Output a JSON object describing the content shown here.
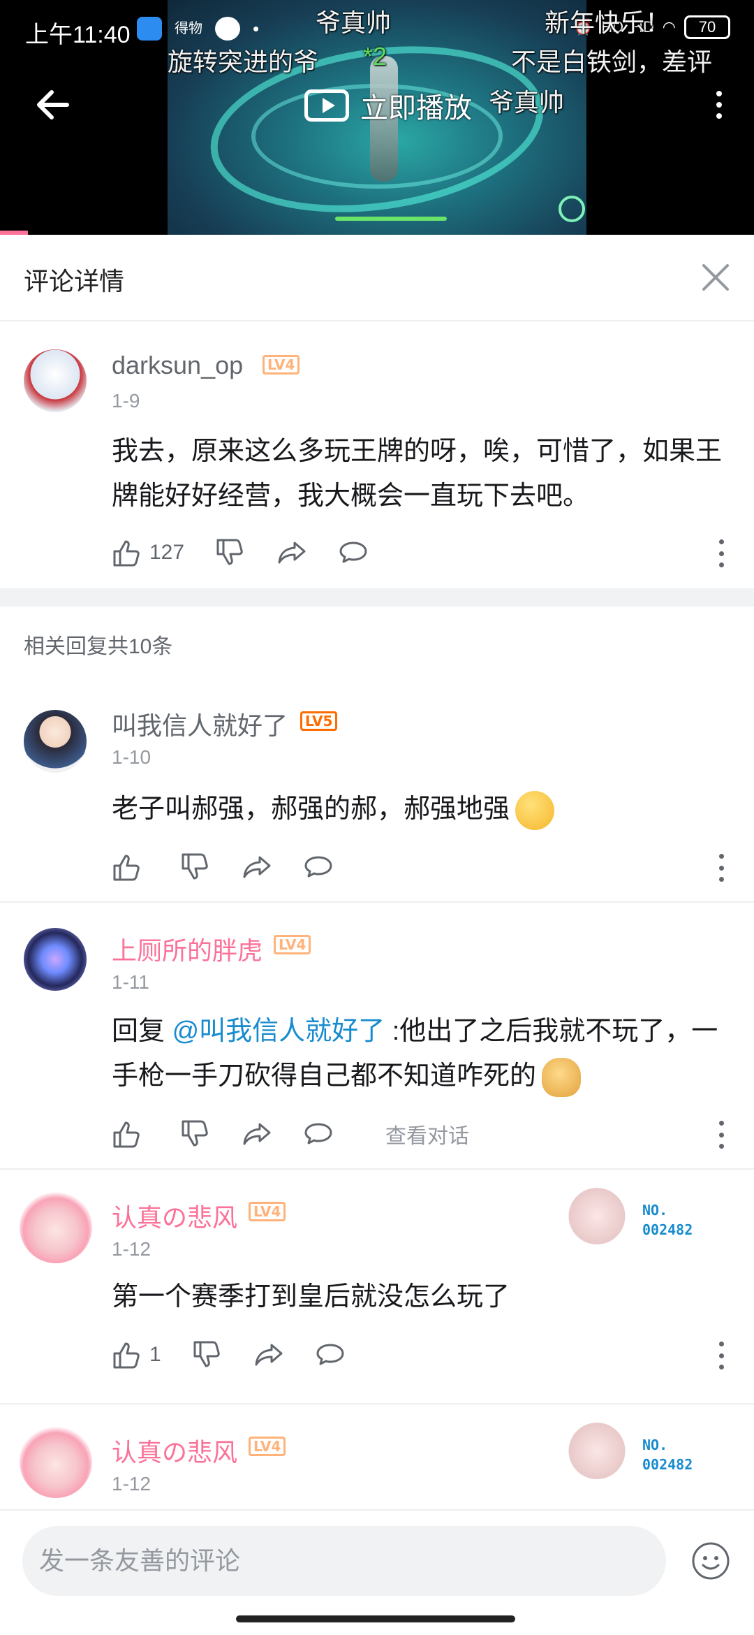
{
  "status_bar": {
    "time": "上午11:40",
    "app_label": "得物",
    "battery": "70",
    "net1": "HD",
    "net2": "HD"
  },
  "video": {
    "play_now_label": "立即播放",
    "danmaku": [
      "爷真帅",
      "新年快乐！",
      "旋转突进的爷",
      "*2",
      "不是白铁剑，差评",
      "爷真帅"
    ]
  },
  "panel": {
    "title": "评论详情"
  },
  "main_comment": {
    "user": "darksun_op",
    "level": "LV4",
    "date": "1-9",
    "text": "我去，原来这么多玩王牌的呀，唉，可惜了，如果王牌能好好经营，我大概会一直玩下去吧。",
    "likes": "127"
  },
  "related_label": "相关回复共10条",
  "replies": [
    {
      "user": "叫我信人就好了",
      "level": "LV5",
      "date": "1-10",
      "text": "老子叫郝强，郝强的郝，郝强地强",
      "likes": ""
    },
    {
      "user": "上厕所的胖虎",
      "level": "LV4",
      "date": "1-11",
      "reply_prefix": "回复 ",
      "mention": "@叫我信人就好了",
      "text": " :他出了之后我就不玩了，一手枪一手刀砍得自己都不知道咋死的",
      "view_conversation": "查看对话",
      "likes": ""
    },
    {
      "user": "认真の悲风",
      "level": "LV4",
      "date": "1-12",
      "text": "第一个赛季打到皇后就没怎么玩了",
      "likes": "1",
      "badge_no": "NO.",
      "badge_id": "002482"
    },
    {
      "user": "认真の悲风",
      "level": "LV4",
      "date": "1-12",
      "badge_no": "NO.",
      "badge_id": "002482"
    }
  ],
  "input": {
    "placeholder": "发一条友善的评论"
  },
  "colors": {
    "accent_pink": "#fb7299",
    "link_blue": "#178bcf",
    "level4": "#ffb27a",
    "level5": "#ff6c00"
  }
}
